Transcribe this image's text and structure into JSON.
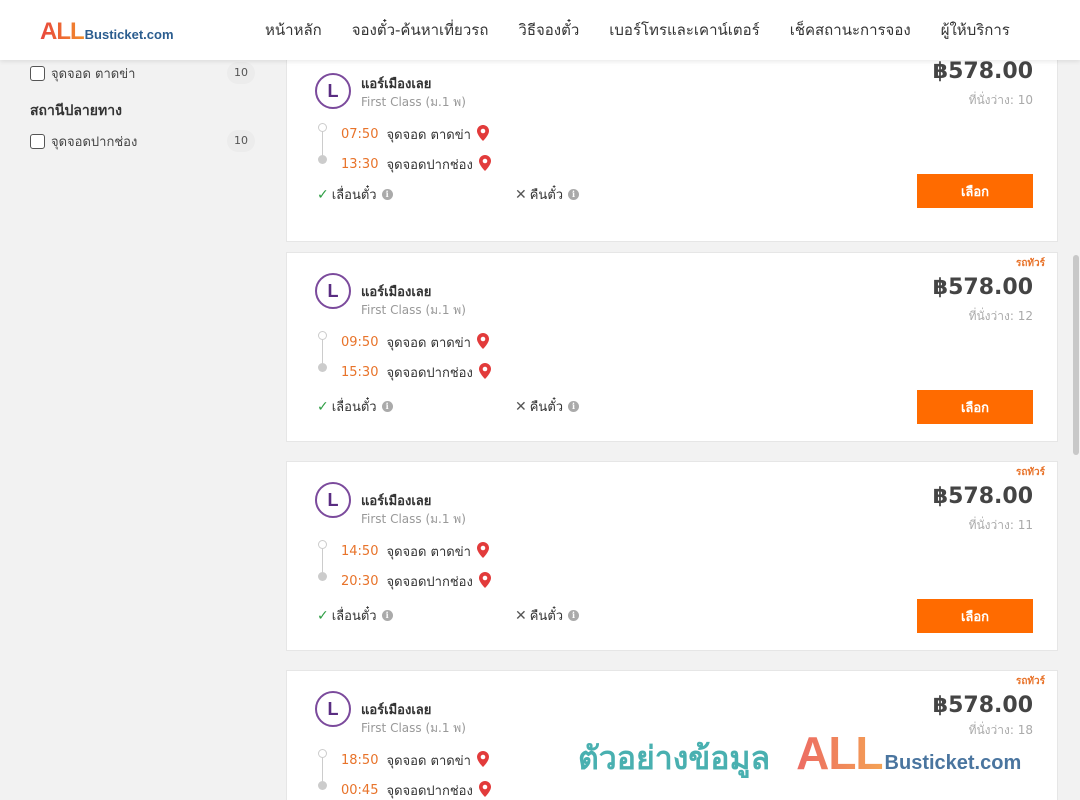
{
  "header": {
    "logo_all": "ALL",
    "logo_rest": "Busticket.com",
    "nav": [
      "หน้าหลัก",
      "จองตั๋ว-ค้นหาเที่ยวรถ",
      "วิธีจองตั๋ว",
      "เบอร์โทรและเคาน์เตอร์",
      "เช็คสถานะการจอง",
      "ผู้ให้บริการ"
    ]
  },
  "sidebar": {
    "origin_filter": {
      "label": "จุดจอด ตาดข่า",
      "count": "10"
    },
    "destination_heading": "สถานีปลายทาง",
    "destination_filter": {
      "label": "จุดจอดปากช่อง",
      "count": "10"
    }
  },
  "trips": [
    {
      "operator": "แอร์เมืองเลย",
      "class": "First Class (ม.1 พ)",
      "depart_time": "07:50",
      "depart_place": "จุดจอด ตาดข่า",
      "arrive_time": "13:30",
      "arrive_place": "จุดจอดปากช่อง",
      "price": "฿578.00",
      "seats": "ที่นั่งว่าง: 10",
      "badge": ""
    },
    {
      "operator": "แอร์เมืองเลย",
      "class": "First Class (ม.1 พ)",
      "depart_time": "09:50",
      "depart_place": "จุดจอด ตาดข่า",
      "arrive_time": "15:30",
      "arrive_place": "จุดจอดปากช่อง",
      "price": "฿578.00",
      "seats": "ที่นั่งว่าง: 12",
      "badge": "รถทัวร์"
    },
    {
      "operator": "แอร์เมืองเลย",
      "class": "First Class (ม.1 พ)",
      "depart_time": "14:50",
      "depart_place": "จุดจอด ตาดข่า",
      "arrive_time": "20:30",
      "arrive_place": "จุดจอดปากช่อง",
      "price": "฿578.00",
      "seats": "ที่นั่งว่าง: 11",
      "badge": "รถทัวร์"
    },
    {
      "operator": "แอร์เมืองเลย",
      "class": "First Class (ม.1 พ)",
      "depart_time": "18:50",
      "depart_place": "จุดจอด ตาดข่า",
      "arrive_time": "00:45",
      "arrive_place": "จุดจอดปากช่อง",
      "price": "฿578.00",
      "seats": "ที่นั่งว่าง: 18",
      "badge": "รถทัวร์"
    }
  ],
  "labels": {
    "reschedule": "เลื่อนตั๋ว",
    "refund": "คืนตั๋ว",
    "select": "เลือก"
  },
  "watermark": {
    "text": "ตัวอย่างข้อมูล",
    "logo_all": "ALL",
    "logo_rest": "Busticket.com"
  },
  "colors": {
    "accent": "#ff6b00",
    "time": "#e8732a",
    "pin": "#e23b3b",
    "check": "#2e9e44"
  }
}
